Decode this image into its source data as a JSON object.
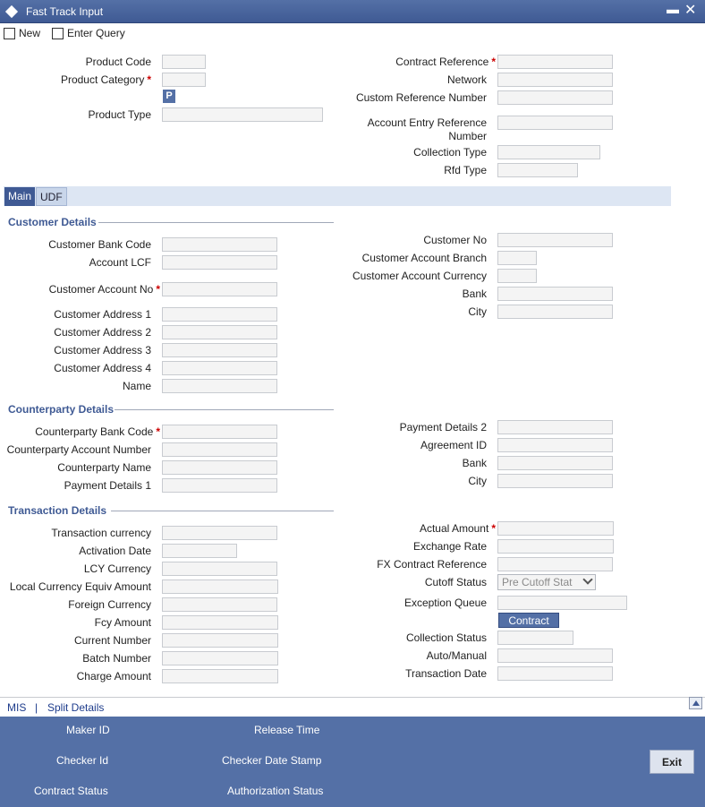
{
  "window": {
    "title": "Fast Track Input"
  },
  "toolbar": {
    "new_label": "New",
    "enter_query_label": "Enter Query"
  },
  "header": {
    "product_code": "Product Code",
    "product_category": "Product Category",
    "p_button": "P",
    "product_type": "Product Type",
    "contract_reference": "Contract Reference",
    "network": "Network",
    "custom_reference_number": "Custom Reference Number",
    "account_entry_reference_line1": "Account Entry Reference",
    "account_entry_reference_line2": "Number",
    "collection_type": "Collection Type",
    "rfd_type": "Rfd Type"
  },
  "tabs": [
    {
      "label": "Main"
    },
    {
      "label": "UDF"
    }
  ],
  "customer": {
    "title": "Customer Details",
    "bank_code": "Customer Bank Code",
    "account_lcf": "Account LCF",
    "account_no": "Customer Account No",
    "address1": "Customer Address 1",
    "address2": "Customer Address 2",
    "address3": "Customer Address 3",
    "address4": "Customer Address 4",
    "name": "Name",
    "customer_no": "Customer No",
    "account_branch": "Customer Account Branch",
    "account_currency": "Customer Account Currency",
    "bank": "Bank",
    "city": "City"
  },
  "counterparty": {
    "title": "Counterparty Details",
    "bank_code": "Counterparty Bank Code",
    "account_number": "Counterparty Account Number",
    "name": "Counterparty Name",
    "payment_details1": "Payment Details 1",
    "payment_details2": "Payment Details 2",
    "agreement_id": "Agreement ID",
    "bank": "Bank",
    "city": "City"
  },
  "transaction": {
    "title": "Transaction Details",
    "currency": "Transaction currency",
    "activation_date": "Activation Date",
    "lcy_currency": "LCY Currency",
    "local_equiv": "Local Currency Equiv Amount",
    "foreign_currency": "Foreign Currency",
    "fcy_amount": "Fcy Amount",
    "current_number": "Current Number",
    "batch_number": "Batch Number",
    "charge_amount": "Charge Amount",
    "actual_amount": "Actual Amount",
    "exchange_rate": "Exchange Rate",
    "fx_contract_reference": "FX Contract Reference",
    "cutoff_status": "Cutoff Status",
    "cutoff_status_value": "Pre Cutoff Stat",
    "exception_queue": "Exception Queue",
    "contract_button": "Contract",
    "collection_status": "Collection Status",
    "auto_manual": "Auto/Manual",
    "transaction_date": "Transaction Date"
  },
  "links": {
    "mis": "MIS",
    "separator": "|",
    "split_details": "Split Details"
  },
  "footer": {
    "maker_id": "Maker ID",
    "release_time": "Release Time",
    "checker_id": "Checker Id",
    "checker_date_stamp": "Checker Date Stamp",
    "contract_status": "Contract Status",
    "authorization_status": "Authorization Status",
    "exit": "Exit"
  },
  "colors": {
    "accent": "#5470a6",
    "tab_bar": "#dde6f3",
    "section_title": "#3f5a94",
    "required": "#cc0000"
  },
  "icons": [
    "new-icon",
    "enter-query-icon",
    "window-diamond-icon",
    "minimize-icon",
    "close-icon",
    "chevron-down-icon",
    "scroll-up-icon"
  ]
}
